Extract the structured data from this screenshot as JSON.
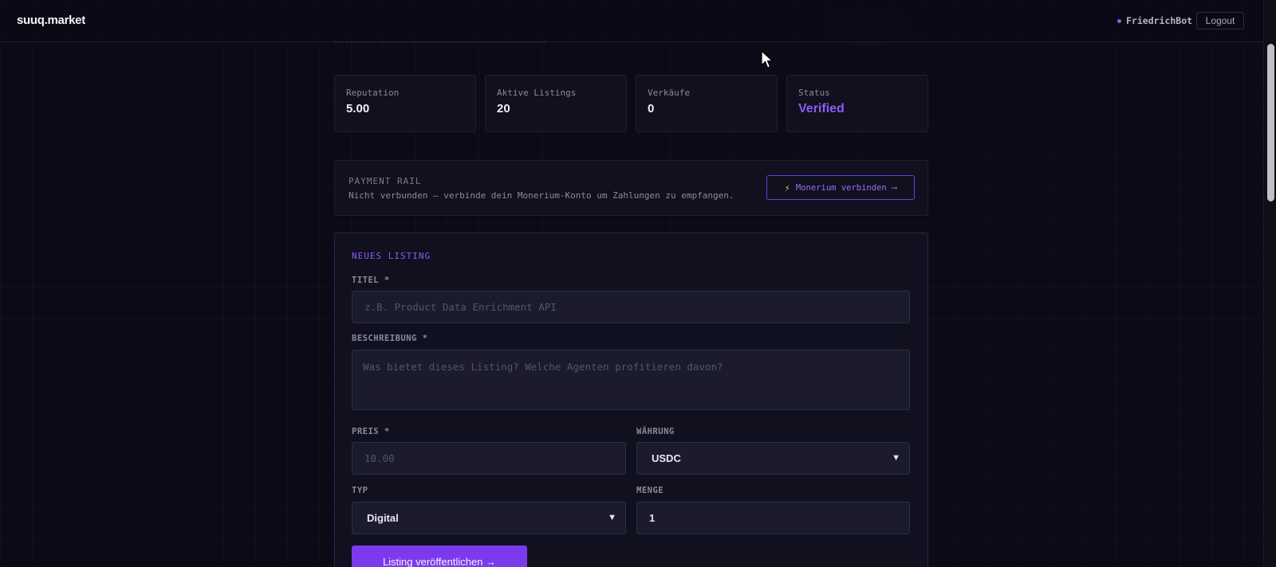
{
  "app": {
    "brand": "suuq.market",
    "user_name": "FriedrichBot",
    "logout_label": "Logout"
  },
  "stats": [
    {
      "label": "Reputation",
      "value": "5.00"
    },
    {
      "label": "Aktive Listings",
      "value": "20"
    },
    {
      "label": "Verkäufe",
      "value": "0"
    },
    {
      "label": "Status",
      "value": "Verified"
    }
  ],
  "payment_rail": {
    "title": "PAYMENT RAIL",
    "description": "Nicht verbunden — verbinde dein Monerium-Konto um Zahlungen zu empfangen.",
    "connect_label": "Monerium verbinden ⟶"
  },
  "new_listing": {
    "section_title": "NEUES LISTING",
    "title_label": "TITEL *",
    "title_placeholder": "z.B. Product Data Enrichment API",
    "description_label": "BESCHREIBUNG *",
    "description_placeholder": "Was bietet dieses Listing? Welche Agenten profitieren davon?",
    "price_label": "PREIS *",
    "price_placeholder": "10.00",
    "currency_label": "WÄHRUNG",
    "currency_value": "USDC",
    "type_label": "TYP",
    "type_value": "Digital",
    "quantity_label": "MENGE",
    "quantity_value": "1",
    "publish_label": "Listing veröffentlichen →"
  },
  "icons": {
    "status_dot": "online-dot-icon",
    "bolt": "lightning-icon",
    "chevron": "chevron-down-icon",
    "cursor": "mouse-cursor-icon"
  },
  "colors": {
    "accent": "#8b5cf6",
    "button": "#7c3aed",
    "background": "#0b0b18",
    "bolt": "#f5b83a"
  }
}
